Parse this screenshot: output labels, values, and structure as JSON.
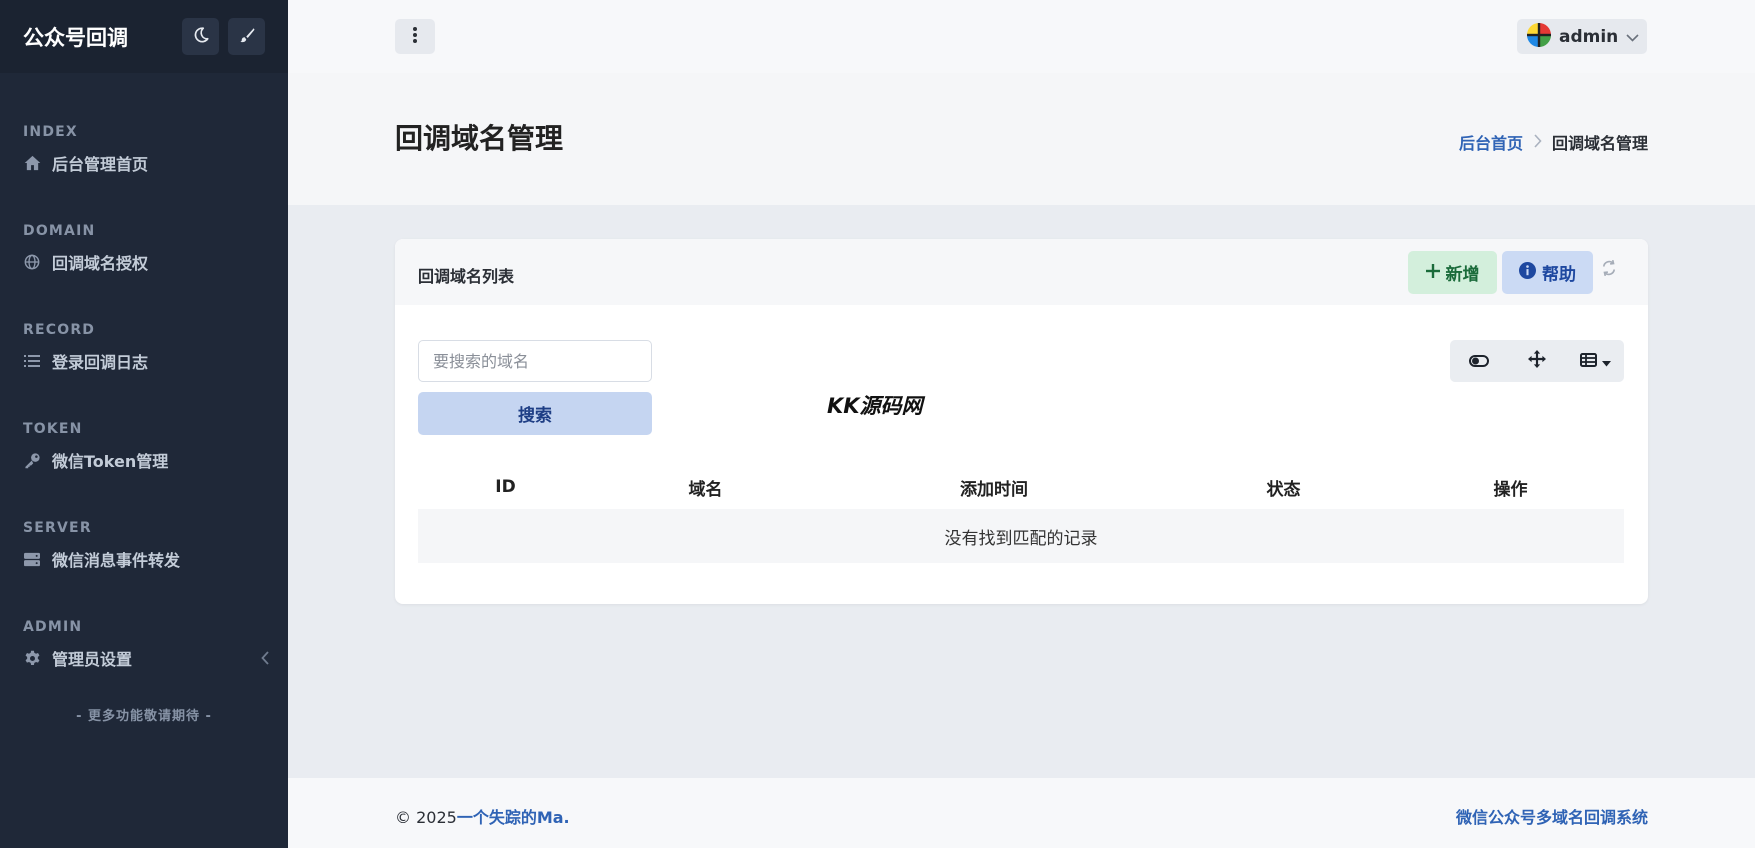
{
  "sidebar": {
    "brand": "公众号回调",
    "sections": [
      {
        "title": "INDEX",
        "item": "后台管理首页",
        "icon": "home-icon"
      },
      {
        "title": "DOMAIN",
        "item": "回调域名授权",
        "icon": "globe-icon"
      },
      {
        "title": "RECORD",
        "item": "登录回调日志",
        "icon": "list-icon"
      },
      {
        "title": "TOKEN",
        "item": "微信Token管理",
        "icon": "key-icon"
      },
      {
        "title": "SERVER",
        "item": "微信消息事件转发",
        "icon": "server-icon"
      },
      {
        "title": "ADMIN",
        "item": "管理员设置",
        "icon": "gear-icon"
      }
    ],
    "more": "- 更多功能敬请期待 -"
  },
  "topbar": {
    "user": "admin"
  },
  "hero": {
    "title": "回调域名管理",
    "breadcrumb_home": "后台首页",
    "breadcrumb_current": "回调域名管理"
  },
  "card": {
    "title": "回调域名列表",
    "add_label": "新增",
    "help_label": "帮助",
    "search_placeholder": "要搜索的域名",
    "search_label": "搜索",
    "watermark": "KK源码网",
    "columns": [
      "ID",
      "域名",
      "添加时间",
      "状态",
      "操作"
    ],
    "empty_text": "没有找到匹配的记录"
  },
  "footer": {
    "copyright": "© 2025",
    "author": "一个失踪的Ma.",
    "system_name": "微信公众号多域名回调系统"
  },
  "colors": {
    "sidebar_bg": "#1f2838",
    "accent": "#2f63b5",
    "add_button_bg": "#d3efdc",
    "help_button_bg": "#cbdaf4"
  }
}
